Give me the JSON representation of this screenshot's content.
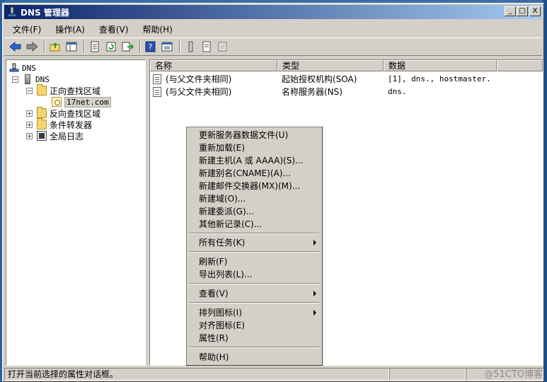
{
  "window": {
    "title": "DNS 管理器",
    "controls": {
      "minimize": "_",
      "maximize": "□",
      "close": "X"
    }
  },
  "menubar": [
    {
      "label": "文件(F)"
    },
    {
      "label": "操作(A)"
    },
    {
      "label": "查看(V)"
    },
    {
      "label": "帮助(H)"
    }
  ],
  "toolbar": {
    "buttons": [
      "back-icon",
      "forward-icon",
      "up-folder-icon",
      "show-hide-tree-icon",
      "properties-icon",
      "refresh-icon",
      "export-list-icon",
      "help-icon",
      "mmc-view-icon",
      "server-icon",
      "record-icon",
      "zone-icon"
    ]
  },
  "tree": {
    "root": "DNS",
    "server": "DNS",
    "forward_zone": "正向查找区域",
    "zone_item": "17net.com",
    "reverse_zone": "反向查找区域",
    "conditional_forwarders": "条件转发器",
    "global_logs": "全局日志",
    "expanded": "−",
    "collapsed": "+"
  },
  "list": {
    "columns": [
      "名称",
      "类型",
      "数据"
    ],
    "rows": [
      {
        "name": "(与父文件夹相同)",
        "type": "起始授权机构(SOA)",
        "data": "[1], dns., hostmaster."
      },
      {
        "name": "(与父文件夹相同)",
        "type": "名称服务器(NS)",
        "data": "dns."
      }
    ]
  },
  "context_menu": {
    "items": [
      "更新服务器数据文件(U)",
      "重新加载(E)",
      "新建主机(A 或 AAAA)(S)...",
      "新建别名(CNAME)(A)...",
      "新建邮件交换器(MX)(M)...",
      "新建域(O)...",
      "新建委派(G)...",
      "其他新记录(C)...",
      "所有任务(K)",
      "刷新(F)",
      "导出列表(L)...",
      "查看(V)",
      "排列图标(I)",
      "对齐图标(E)",
      "属性(R)",
      "帮助(H)"
    ]
  },
  "statusbar": {
    "text": "打开当前选择的属性对话框。"
  },
  "watermark": "@51CTO博客",
  "colors": {
    "titlebar_start": "#0a246a",
    "titlebar_end": "#a6caf0",
    "face": "#d4d0c8"
  }
}
